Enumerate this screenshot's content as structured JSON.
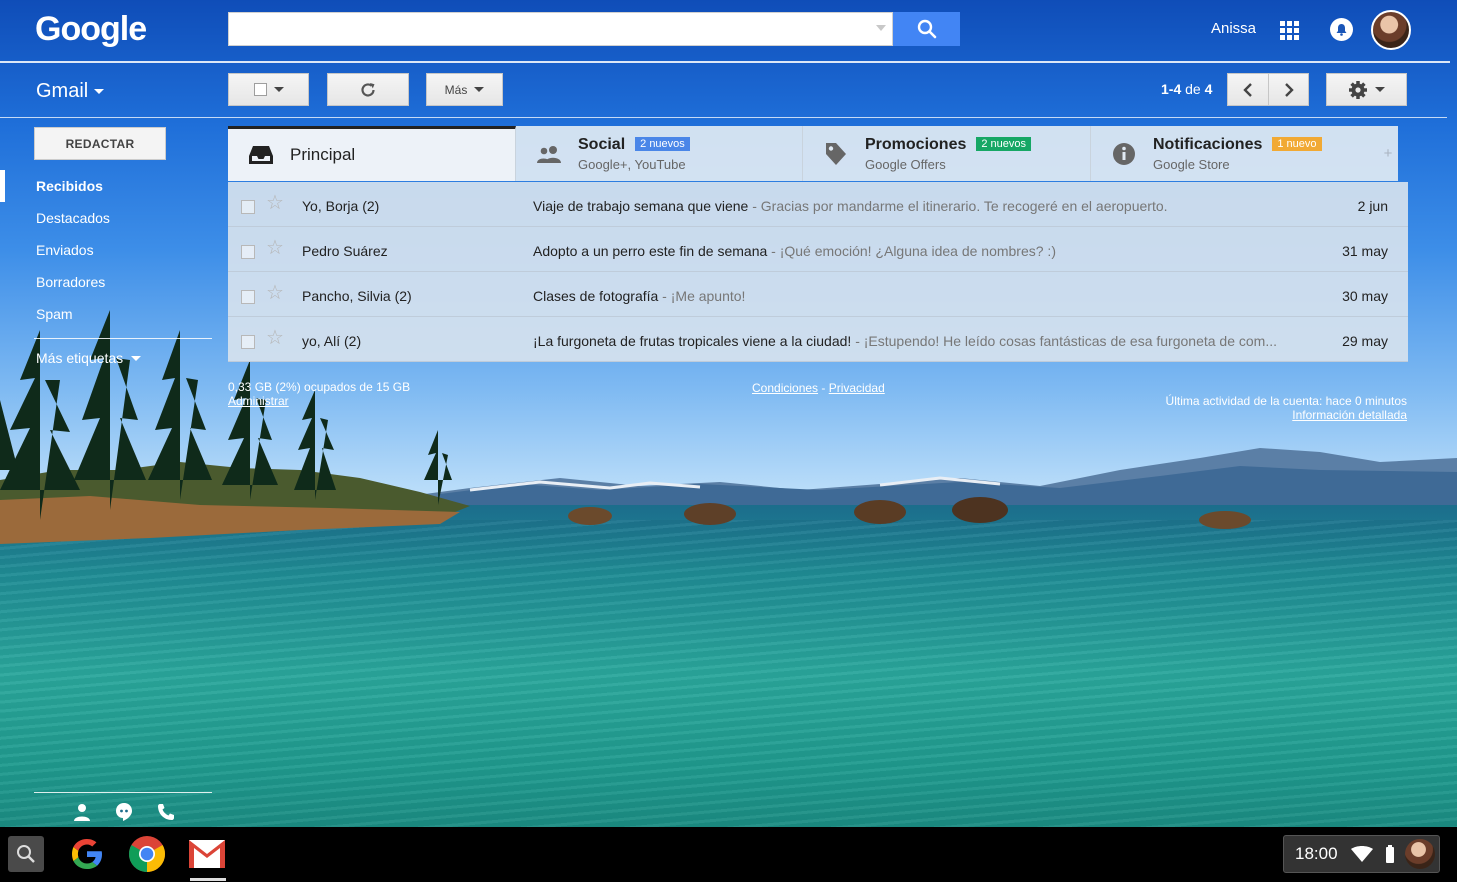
{
  "header": {
    "logo": "Google",
    "search_placeholder": "",
    "user_name": "Anissa",
    "search_icon": "search-icon",
    "apps_icon": "apps-grid-icon",
    "notifications_icon": "bell-icon"
  },
  "toolbar": {
    "app_label": "Gmail",
    "more_label": "Más",
    "pager_range": "1-4",
    "pager_of": " de ",
    "pager_total": "4"
  },
  "sidebar": {
    "compose_label": "REDACTAR",
    "items": [
      {
        "label": "Recibidos"
      },
      {
        "label": "Destacados"
      },
      {
        "label": "Enviados"
      },
      {
        "label": "Borradores"
      },
      {
        "label": "Spam"
      }
    ],
    "more_labels": "Más etiquetas"
  },
  "tabs": [
    {
      "title": "Principal",
      "subtitle": "",
      "badge": ""
    },
    {
      "title": "Social",
      "subtitle": "Google+, YouTube",
      "badge": "2 nuevos",
      "badge_color": "#4a86e8"
    },
    {
      "title": "Promociones",
      "subtitle": "Google Offers",
      "badge": "2 nuevos",
      "badge_color": "#16a765"
    },
    {
      "title": "Notificaciones",
      "subtitle": "Google Store",
      "badge": "1 nuevo",
      "badge_color": "#f1a934"
    }
  ],
  "emails": [
    {
      "sender": "Yo, Borja (2)",
      "subject": "Viaje de trabajo semana que viene",
      "snippet": " - Gracias por mandarme el itinerario. Te recogeré en el aeropuerto.",
      "date": "2 jun"
    },
    {
      "sender": "Pedro Suárez",
      "subject": "Adopto a un perro este fin de semana",
      "snippet": " - ¡Qué emoción! ¿Alguna idea de nombres? :)",
      "date": "31 may"
    },
    {
      "sender": "Pancho, Silvia (2)",
      "subject": "Clases de fotografía",
      "snippet": " - ¡Me apunto!",
      "date": "30 may"
    },
    {
      "sender": "yo, Alí (2)",
      "subject": "¡La furgoneta de frutas tropicales viene a la ciudad!",
      "snippet": " - ¡Estupendo! He leído cosas fantásticas de esa furgoneta de com...",
      "date": "29 may"
    }
  ],
  "footer": {
    "storage": "0,33 GB (2%) ocupados de 15 GB",
    "manage": "Administrar",
    "terms": "Condiciones",
    "sep": " - ",
    "privacy": "Privacidad",
    "activity": "Última actividad de la cuenta: hace 0 minutos",
    "details": "Información detallada"
  },
  "taskbar": {
    "time": "18:00",
    "apps": [
      "google-app-icon",
      "chrome-app-icon",
      "gmail-app-icon"
    ]
  },
  "colors": {
    "accent_blue": "#4285f4",
    "badge_social": "#4a86e8",
    "badge_promos": "#16a765",
    "badge_notif": "#f1a934"
  }
}
